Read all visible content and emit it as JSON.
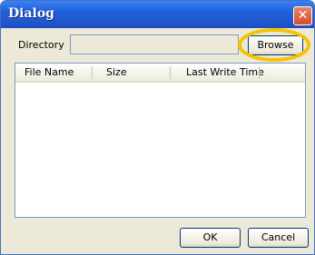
{
  "window": {
    "title": "Dialog",
    "close_symbol": "✕"
  },
  "directory": {
    "label": "Directory",
    "value": ""
  },
  "buttons": {
    "browse": "Browse",
    "ok": "OK",
    "cancel": "Cancel"
  },
  "file_list": {
    "columns": [
      "File Name",
      "Size",
      "Last Write Time"
    ],
    "rows": []
  },
  "colors": {
    "titlebar": "#2158d1",
    "highlight": "#f5c400",
    "close": "#d44c2a"
  }
}
